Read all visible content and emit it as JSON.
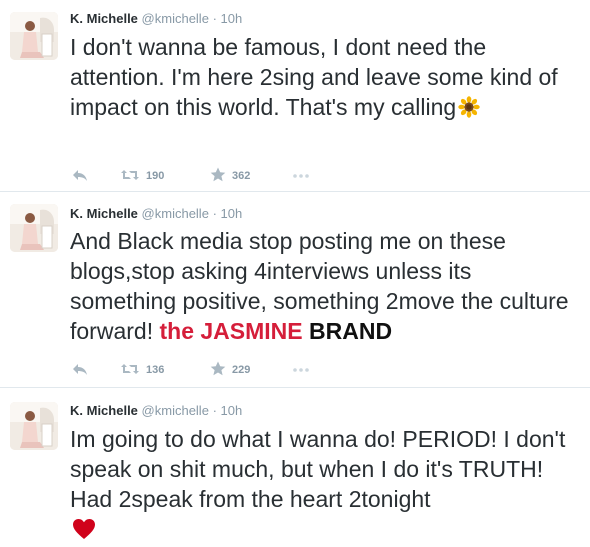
{
  "tweets": [
    {
      "display_name": "K. Michelle",
      "handle": "@kmichelle",
      "separator": "·",
      "time": "10h",
      "text": "I don't wanna be famous, I dont need the attention. I'm here 2sing and leave some kind of impact on this world. That's my calling",
      "emoji": "sunflower-emoji",
      "retweets": "190",
      "favorites": "362"
    },
    {
      "display_name": "K. Michelle",
      "handle": "@kmichelle",
      "separator": "·",
      "time": "10h",
      "text": "And Black media stop posting me on these blogs,stop asking 4interviews unless its something positive, something 2move the culture forward!",
      "retweets": "136",
      "favorites": "229"
    },
    {
      "display_name": "K. Michelle",
      "handle": "@kmichelle",
      "separator": "·",
      "time": "10h",
      "text": "Im going to do what I wanna do! PERIOD! I don't speak on shit much, but when I do it's TRUTH! Had 2speak from the heart 2tonight",
      "emoji": "red-heart-emoji"
    }
  ],
  "watermark": {
    "the": "the",
    "jasmine": "JASMINE",
    "brand": "BRAND"
  },
  "colors": {
    "text": "#292f33",
    "secondary": "#8899a6",
    "divider": "#e1e8ed",
    "watermark_red": "#d51e3a",
    "heart": "#d0021b",
    "sunflower": "#f5b400"
  },
  "icons": [
    "reply-icon",
    "retweet-icon",
    "favorite-star-icon",
    "more-icon"
  ]
}
